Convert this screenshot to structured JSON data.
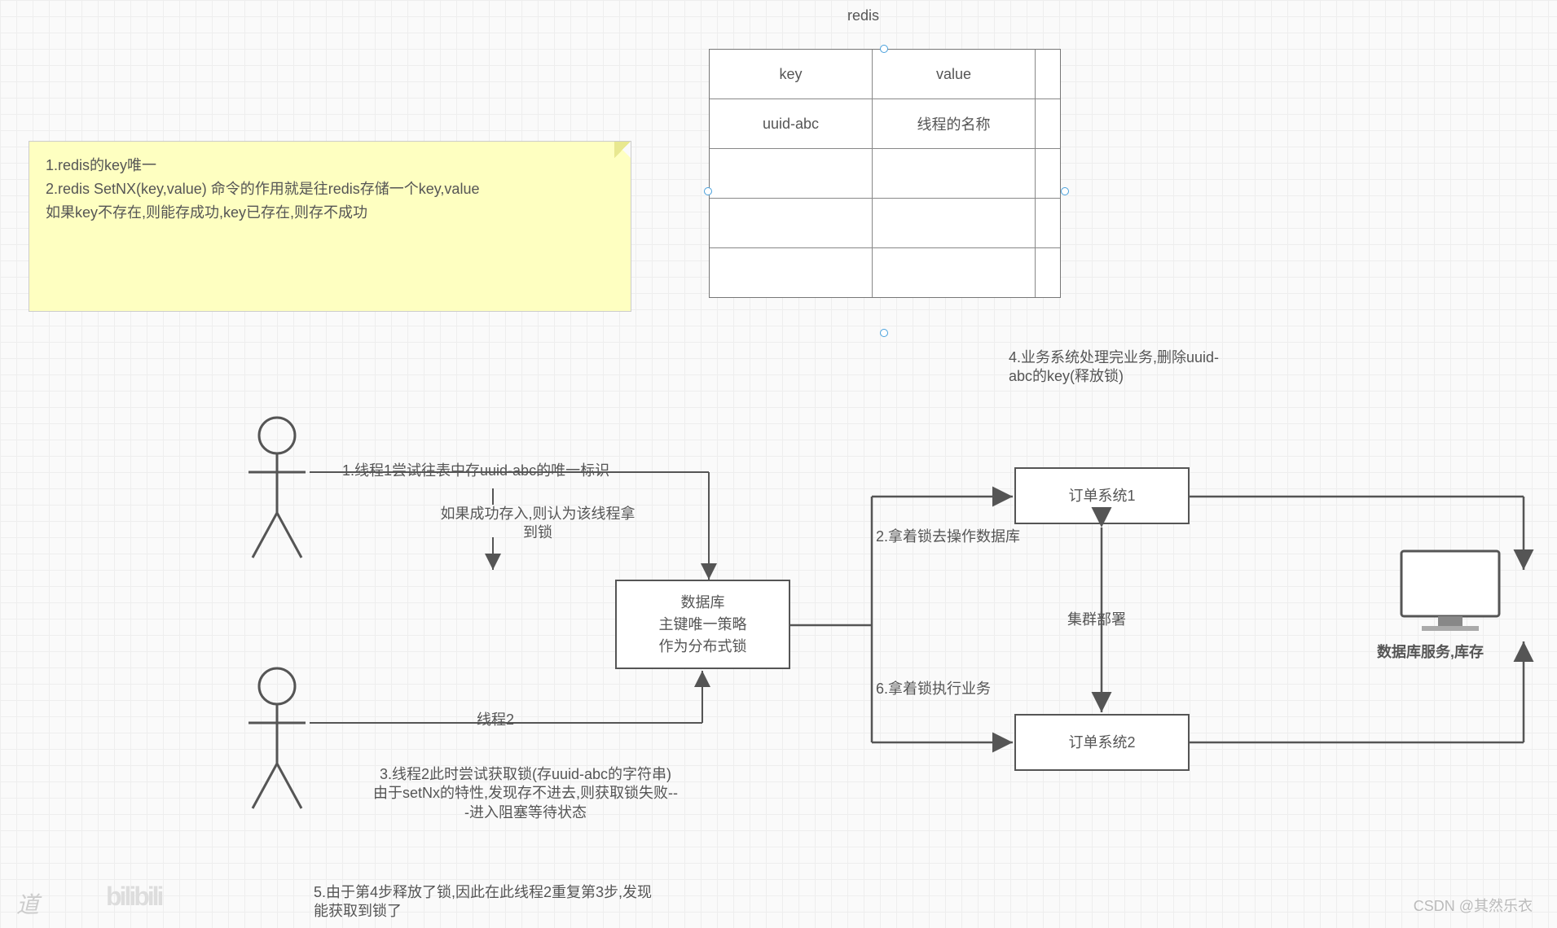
{
  "title": "redis",
  "note": {
    "line1": "1.redis的key唯一",
    "line2": "2.redis SetNX(key,value) 命令的作用就是往redis存储一个key,value",
    "line3": "如果key不存在,则能存成功,key已存在,则存不成功"
  },
  "table": {
    "header_key": "key",
    "header_value": "value",
    "row1_key": "uuid-abc",
    "row1_value": "线程的名称"
  },
  "annotations": {
    "step4": "4.业务系统处理完业务,删除uuid-abc的key(释放锁)",
    "step1": "1.线程1尝试往表中存uuid-abc的唯一标识",
    "step1_sub": "如果成功存入,则认为该线程拿到锁",
    "step2": "2.拿着锁去操作数据库",
    "cluster": "集群部署",
    "step6": "6.拿着锁执行业务",
    "thread2": "线程2",
    "step3": "3.线程2此时尝试获取锁(存uuid-abc的字符串)\n由于setNx的特性,发现存不进去,则获取锁失败--\n-进入阻塞等待状态",
    "step5": "5.由于第4步释放了锁,因此在此线程2重复第3步,发现能获取到锁了"
  },
  "boxes": {
    "db": "数据库\n主键唯一策略\n作为分布式锁",
    "order1": "订单系统1",
    "order2": "订单系统2",
    "db_service": "数据库服务,库存"
  },
  "watermarks": {
    "w1": "道",
    "w2": "bilibili",
    "attribution": "CSDN @其然乐衣"
  }
}
